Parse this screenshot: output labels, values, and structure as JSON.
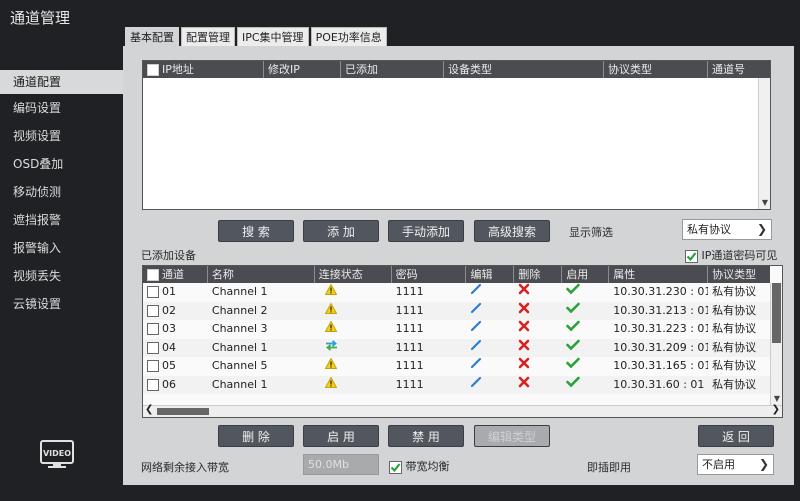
{
  "window": {
    "title": "通道管理"
  },
  "tabs": [
    "基本配置",
    "配置管理",
    "IPC集中管理",
    "POE功率信息"
  ],
  "sidebar": {
    "items": [
      "通道配置",
      "编码设置",
      "视频设置",
      "OSD叠加",
      "移动侦测",
      "遮挡报警",
      "报警输入",
      "视频丢失",
      "云镜设置"
    ]
  },
  "search_table": {
    "columns": [
      "IP地址",
      "修改IP",
      "已添加",
      "设备类型",
      "协议类型",
      "通道号"
    ]
  },
  "search_buttons": {
    "search": "搜 索",
    "add": "添 加",
    "manual_add": "手动添加",
    "advanced_search": "高级搜索"
  },
  "filter": {
    "label": "显示筛选",
    "value": "私有协议"
  },
  "added_devices": {
    "label": "已添加设备",
    "ip_password_visible_label": "IP通道密码可见",
    "columns": [
      "通道",
      "名称",
      "连接状态",
      "密码",
      "编辑",
      "删除",
      "启用",
      "属性",
      "协议类型"
    ],
    "rows": [
      {
        "channel": "01",
        "name": "Channel 1",
        "status": "warning-icon",
        "password": "1111",
        "address": "10.30.31.230 : 01",
        "protocol": "私有协议"
      },
      {
        "channel": "02",
        "name": "Channel 2",
        "status": "warning-icon",
        "password": "1111",
        "address": "10.30.31.213 : 01",
        "protocol": "私有协议"
      },
      {
        "channel": "03",
        "name": "Channel 3",
        "status": "warning-icon",
        "password": "1111",
        "address": "10.30.31.223 : 01",
        "protocol": "私有协议"
      },
      {
        "channel": "04",
        "name": "Channel 1",
        "status": "connected-icon",
        "password": "1111",
        "address": "10.30.31.209 : 01",
        "protocol": "私有协议"
      },
      {
        "channel": "05",
        "name": "Channel 5",
        "status": "warning-icon",
        "password": "1111",
        "address": "10.30.31.165 : 01",
        "protocol": "私有协议"
      },
      {
        "channel": "06",
        "name": "Channel 1",
        "status": "warning-icon",
        "password": "1111",
        "address": "10.30.31.60 : 01",
        "protocol": "私有协议"
      }
    ]
  },
  "bottom_buttons": {
    "delete": "删 除",
    "enable": "启 用",
    "disable": "禁 用",
    "edit_type": "编辑类型",
    "back": "返 回"
  },
  "bandwidth": {
    "label": "网络剩余接入带宽",
    "value": "50.0Mb",
    "balance_label": "带宽均衡"
  },
  "plug_and_play": {
    "label": "即插即用",
    "value": "不启用"
  }
}
